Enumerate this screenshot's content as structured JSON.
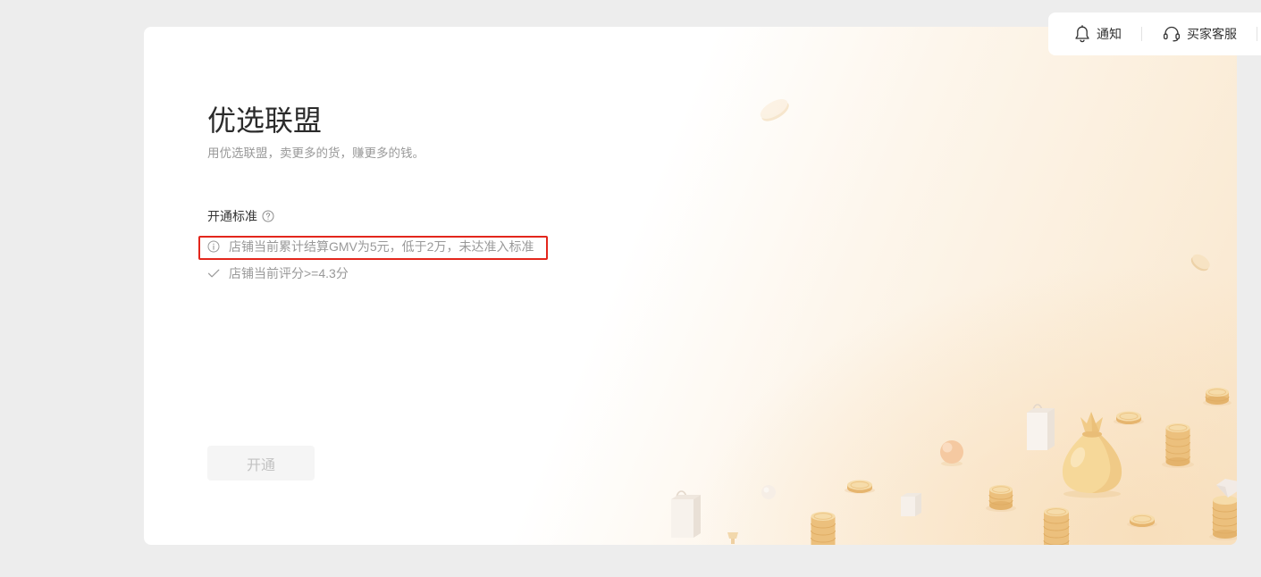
{
  "topbar": {
    "notify": {
      "label": "通知",
      "icon": "bell-icon"
    },
    "service": {
      "label": "买家客服",
      "icon": "headset-icon"
    }
  },
  "header": {
    "title": "优选联盟",
    "subtitle": "用优选联盟，卖更多的货，赚更多的钱。"
  },
  "criteria": {
    "heading": "开通标准",
    "help_icon": "question-circle-icon",
    "items": [
      {
        "icon": "info-circle-icon",
        "text": "店铺当前累计结算GMV为5元，低于2万，未达准入标准"
      },
      {
        "icon": "check-icon",
        "text": "店铺当前评分>=4.3分"
      }
    ]
  },
  "actions": {
    "open_label": "开通",
    "open_disabled": true
  },
  "colors": {
    "page_bg": "#ededed",
    "text_primary": "#333333",
    "text_secondary": "#999999",
    "highlight_border": "#e3261c",
    "button_disabled_bg": "#f5f5f5",
    "button_disabled_text": "#c2c2c2"
  }
}
